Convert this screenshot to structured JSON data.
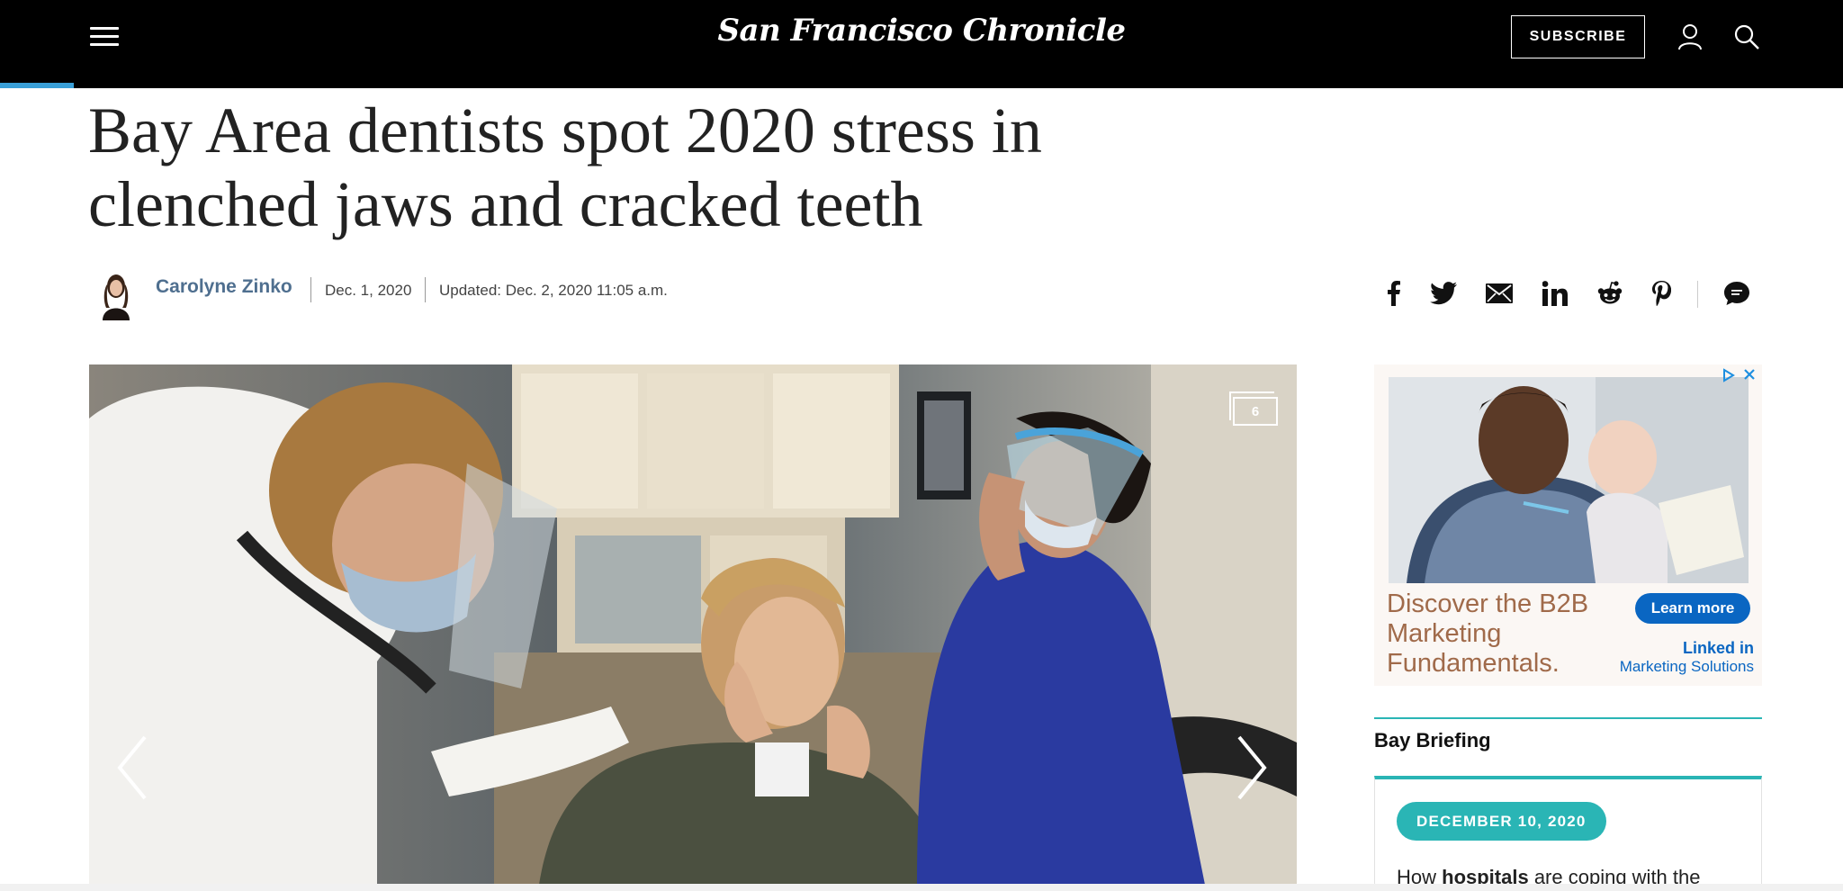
{
  "header": {
    "logo": "San Francisco Chronicle",
    "subscribe_label": "SUBSCRIBE",
    "icons": [
      "menu-icon",
      "user-icon",
      "search-icon"
    ],
    "read_progress": 0.04
  },
  "article": {
    "headline": "Bay Area dentists spot 2020 stress in clenched jaws and cracked teeth",
    "author": "Carolyne Zinko",
    "date": "Dec. 1, 2020",
    "updated": "Updated: Dec. 2, 2020 11:05 a.m.",
    "share_icons": [
      "facebook-icon",
      "twitter-icon",
      "email-icon",
      "linkedin-icon",
      "reddit-icon",
      "pinterest-icon",
      "comments-icon"
    ]
  },
  "gallery": {
    "count": "6",
    "prev_icon": "chevron-left-icon",
    "next_icon": "chevron-right-icon"
  },
  "ad": {
    "text": "Discover the B2B Marketing Fundamentals.",
    "button": "Learn more",
    "brand_line1": "Linked in",
    "brand_line2": "Marketing Solutions"
  },
  "briefing": {
    "title": "Bay Briefing",
    "badge": "DECEMBER 10, 2020",
    "text_pre": "How ",
    "text_bold": "hospitals",
    "text_post": " are coping with the"
  },
  "colors": {
    "accent_teal": "#2ab5b5",
    "author_link": "#4f6f8f",
    "progress": "#3aa0d8",
    "linkedin_blue": "#0a66c2"
  }
}
